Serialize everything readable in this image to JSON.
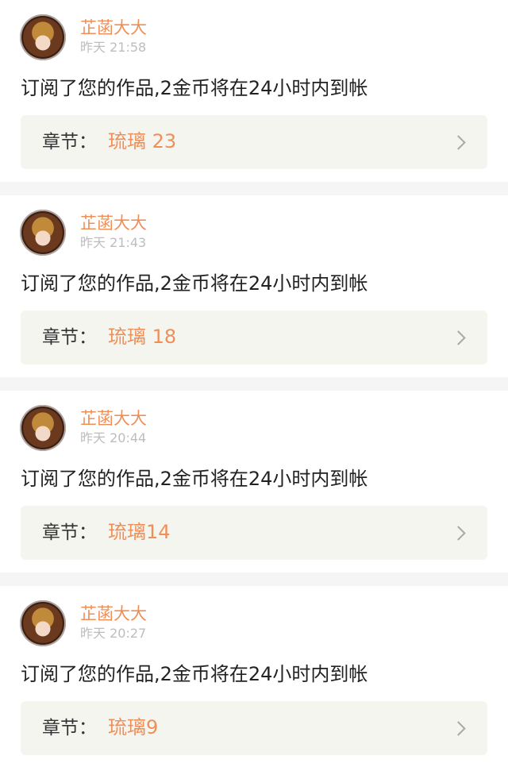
{
  "notifications": [
    {
      "user_name": "芷菡大大",
      "time": "昨天 21:58",
      "message": "订阅了您的作品,2金币将在24小时内到帐",
      "chapter_prefix": "章节：",
      "chapter_title": "琉璃 23"
    },
    {
      "user_name": "芷菡大大",
      "time": "昨天 21:43",
      "message": "订阅了您的作品,2金币将在24小时内到帐",
      "chapter_prefix": "章节：",
      "chapter_title": "琉璃 18"
    },
    {
      "user_name": "芷菡大大",
      "time": "昨天 20:44",
      "message": "订阅了您的作品,2金币将在24小时内到帐",
      "chapter_prefix": "章节：",
      "chapter_title": "琉璃14"
    },
    {
      "user_name": "芷菡大大",
      "time": "昨天 20:27",
      "message": "订阅了您的作品,2金币将在24小时内到帐",
      "chapter_prefix": "章节：",
      "chapter_title": "琉璃9"
    }
  ],
  "icons": {
    "chevron": "chevron-right-icon"
  },
  "colors": {
    "accent": "#ef8f58",
    "text": "#222222",
    "muted": "#bdbdbd",
    "chip_bg": "#f5f5f0"
  }
}
